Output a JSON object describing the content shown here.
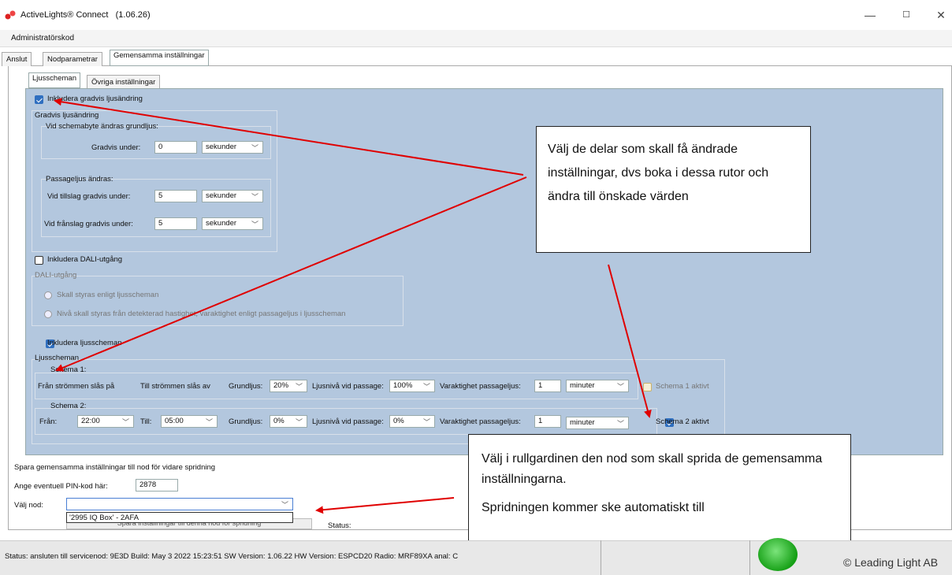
{
  "window": {
    "title": "ActiveLights® Connect",
    "version": "(1.06.26)",
    "minimize": "—",
    "maximize": "☐",
    "close": "✕"
  },
  "menu": {
    "admin": "Administratörskod"
  },
  "main_tabs": [
    "Anslut",
    "Nodparametrar",
    "Gemensamma inställningar"
  ],
  "sub_tabs": [
    "Ljusscheman",
    "Övriga inställningar"
  ],
  "gradual": {
    "checkbox": "Inkludera gradvis ljusändring",
    "group": "Gradvis ljusändring",
    "subgroup1": "Vid schemabyte ändras grundljus:",
    "gradually_under": "Gradvis under:",
    "gradually_value": "0",
    "unit": "sekunder",
    "subgroup2": "Passageljus ändras:",
    "on_label": "Vid tillslag gradvis under:",
    "on_value": "5",
    "off_label": "Vid frånslag gradvis under:",
    "off_value": "5"
  },
  "dali": {
    "checkbox": "Inkludera DALI-utgång",
    "group": "DALI-utgång",
    "radio1": "Skall styras enligt ljusscheman",
    "radio2": "Nivå skall styras från detekterad hastighet, varaktighet enligt passageljus i ljusscheman"
  },
  "schemes": {
    "checkbox": "Inkludera ljusscheman",
    "group": "Ljusscheman",
    "s1": {
      "title": "Schema 1:",
      "from": "Från strömmen slås på",
      "to": "Till strömmen slås av",
      "base_label": "Grundljus:",
      "base": "20%",
      "level_label": "Ljusnivå vid passage:",
      "level": "100%",
      "dur_label": "Varaktighet passageljus:",
      "dur": "1",
      "dur_unit": "minuter",
      "active": "Schema 1 aktivt"
    },
    "s2": {
      "title": "Schema 2:",
      "from_label": "Från:",
      "from": "22:00",
      "to_label": "Till:",
      "to": "05:00",
      "base_label": "Grundljus:",
      "base": "0%",
      "level_label": "Ljusnivå vid passage:",
      "level": "0%",
      "dur_label": "Varaktighet passageljus:",
      "dur": "1",
      "dur_unit": "minuter",
      "active": "Schema 2 aktivt"
    }
  },
  "spread": {
    "title": "Spara gemensamma inställningar till nod för vidare spridning",
    "pin_label": "Ange eventuell PIN-kod här:",
    "pin": "2878",
    "node_label": "Välj nod:",
    "node_option": "'2995 IQ Box' - 2AFA",
    "save_button": "Spara inställningar till denna nod för spridning",
    "status_label": "Status:"
  },
  "annotations": {
    "a1": "Välj de delar som skall få ändrade inställningar, dvs boka i dessa rutor och ändra till önskade värden",
    "a2_line1": "Välj i rullgardinen den nod som skall sprida de gemensamma inställningarna.",
    "a2_line2": "Spridningen kommer ske automatiskt till"
  },
  "statusbar": {
    "text": "Status: ansluten till servicenod: 9E3D   Build:  May  3 2022   15:23:51    SW Version: 1.06.22   HW Version: ESPCD20    Radio:  MRF89XA anal: C",
    "copyright": "© Leading Light AB"
  },
  "colors": {
    "panel_blue": "#b3c7de",
    "arrow_red": "#e00000",
    "led_green": "#16a016"
  }
}
